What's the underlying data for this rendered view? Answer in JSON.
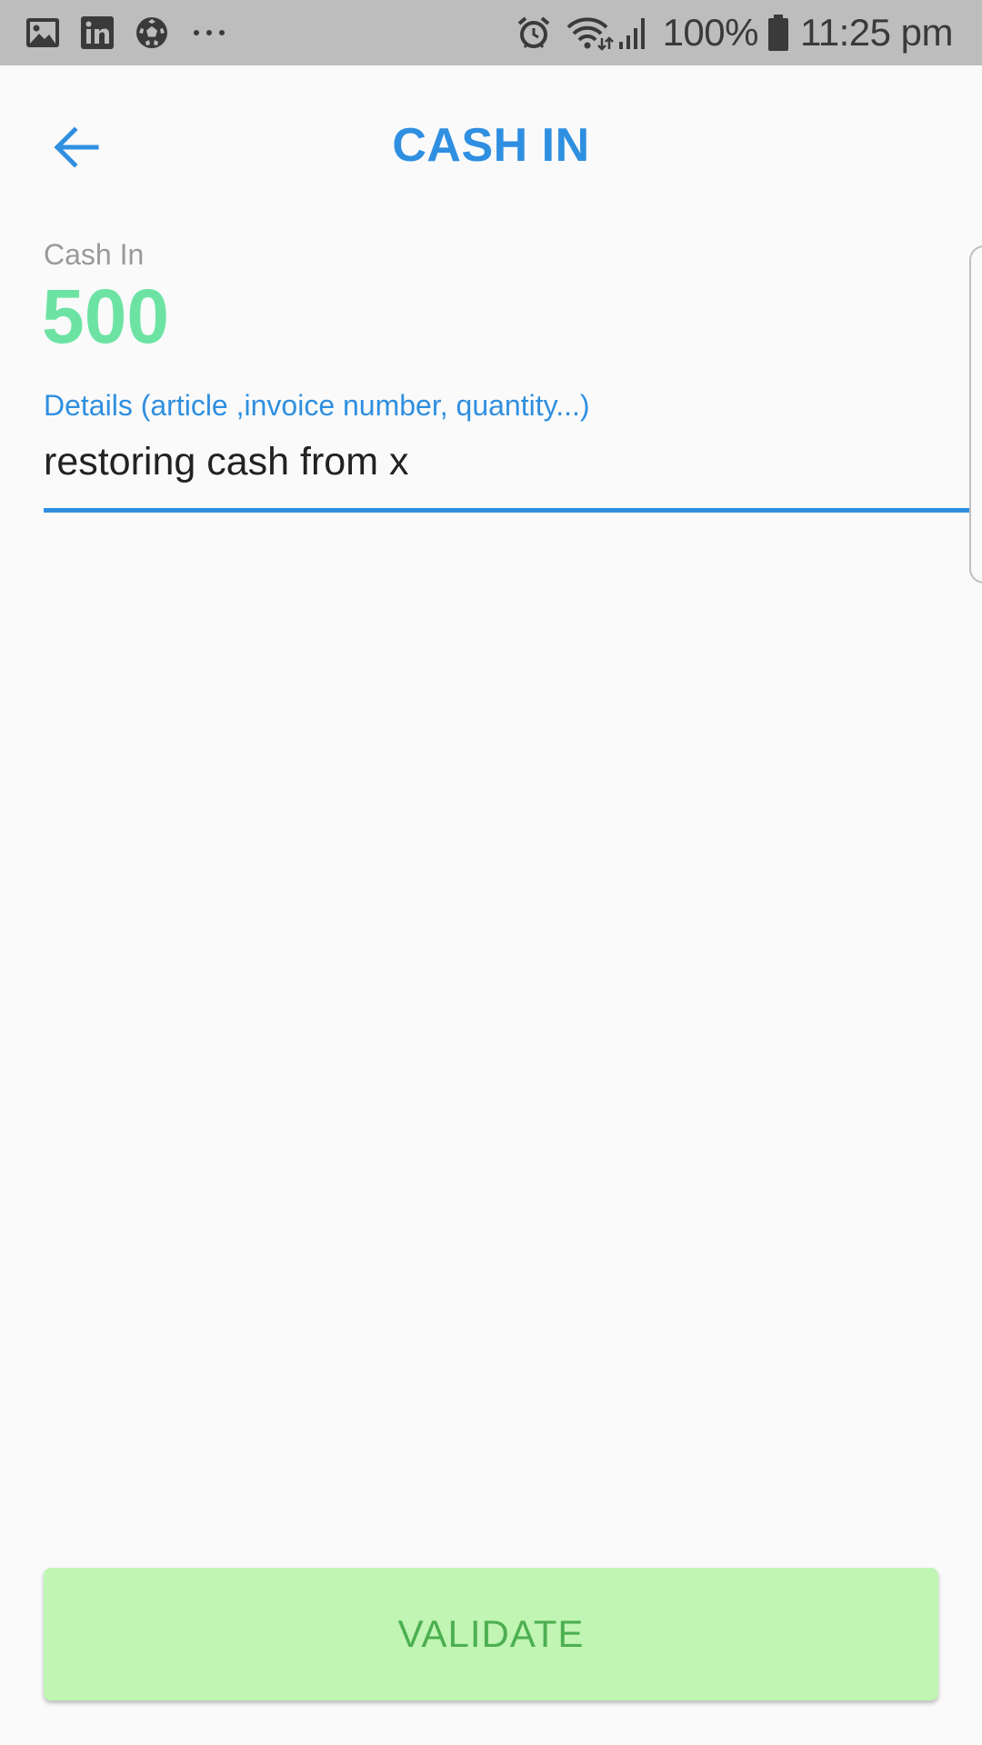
{
  "status_bar": {
    "notification_icons": [
      "gallery-icon",
      "linkedin-icon",
      "soccer-ball-icon",
      "more-dots-icon"
    ],
    "system_icons": [
      "alarm-icon",
      "wifi-icon",
      "signal-icon",
      "battery-icon"
    ],
    "battery": "100%",
    "time": "11:25 pm",
    "background_color": "#bdbdbd"
  },
  "app_bar": {
    "back_icon": "arrow-left-icon",
    "title": "CASH IN",
    "accent_color": "#2f8fe0"
  },
  "form": {
    "cash_label": "Cash In",
    "cash_amount": "500",
    "amount_color": "#6de3a3",
    "details_label": "Details (article ,invoice number, quantity...)",
    "details_value": "restoring cash from x"
  },
  "validate_button": {
    "label": "VALIDATE",
    "background_color": "#c0f5b4",
    "text_color": "#4caf50"
  }
}
